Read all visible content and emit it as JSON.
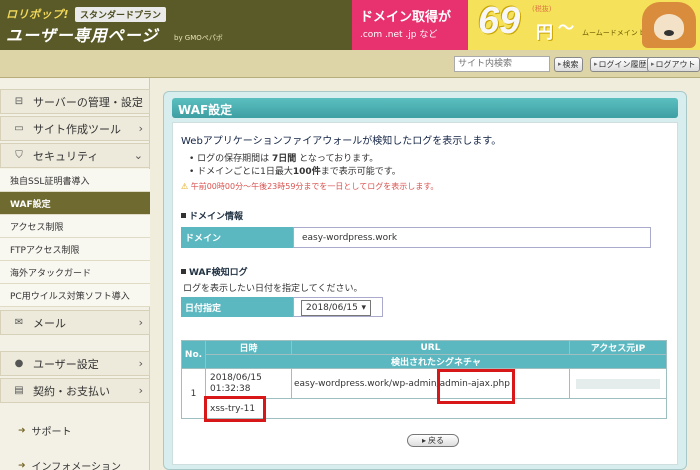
{
  "header": {
    "brand": "ロリポップ!",
    "plan_badge": "スタンダードプラン",
    "title": "ユーザー専用ページ",
    "by": "by GMOペパボ",
    "banner": {
      "title": "ドメイン取得が",
      "sub": ".com .net .jp など",
      "price": "69",
      "tax_note": "(税抜)",
      "yen": "円",
      "tilde": "〜",
      "campaign": "ムームードメイン by GMOペパボ"
    }
  },
  "toolbar": {
    "search_placeholder": "サイト内検索",
    "search_label": "検索",
    "login_history_label": "ログイン履歴",
    "logout_label": "ログアウト"
  },
  "sidebar": {
    "server_mgmt": "サーバーの管理・設定",
    "site_tools": "サイト作成ツール",
    "security": "セキュリティ",
    "security_items": [
      "独自SSL証明書導入",
      "WAF設定",
      "アクセス制限",
      "FTPアクセス制限",
      "海外アタックガード",
      "PC用ウイルス対策ソフト導入"
    ],
    "mail": "メール",
    "user_settings": "ユーザー設定",
    "billing": "契約・お支払い",
    "support": "サポート",
    "info": "インフォメーション"
  },
  "main": {
    "title": "WAF設定",
    "intro": "Webアプリケーションファイアウォールが検知したログを表示します。",
    "bullet1_pre": "ログの保存期間は ",
    "bullet1_em": "7日間",
    "bullet1_post": " となっております。",
    "bullet2_pre": "ドメインごとに1日最大",
    "bullet2_em": "100件",
    "bullet2_post": "まで表示可能です。",
    "warning": "午前00時00分～午後23時59分までを一日としてログを表示します。",
    "domain_section": "ドメイン情報",
    "domain_label": "ドメイン",
    "domain_value": "easy-wordpress.work",
    "log_section": "WAF検知ログ",
    "log_instruction": "ログを表示したい日付を指定してください。",
    "date_label": "日付指定",
    "date_value": "2018/06/15",
    "table": {
      "col_no": "No.",
      "col_datetime": "日時",
      "col_url": "URL",
      "col_ip": "アクセス元IP",
      "col_signature": "検出されたシグネチャ",
      "rows": [
        {
          "no": "1",
          "date": "2018/06/15",
          "time": "01:32:38",
          "url_prefix": "easy-wordpress.work/wp-admin/",
          "url_file": "admin-ajax.php",
          "ip": "",
          "signature": "xss-try-11"
        }
      ]
    },
    "back_label": "戻る"
  },
  "colors": {
    "header_bg": "#5a5a28",
    "panel_title": "#3e9fa2",
    "table_header": "#5bb8c0",
    "highlight": "#d81818",
    "active_nav": "#6f6a2f",
    "warning": "#d9534f"
  }
}
